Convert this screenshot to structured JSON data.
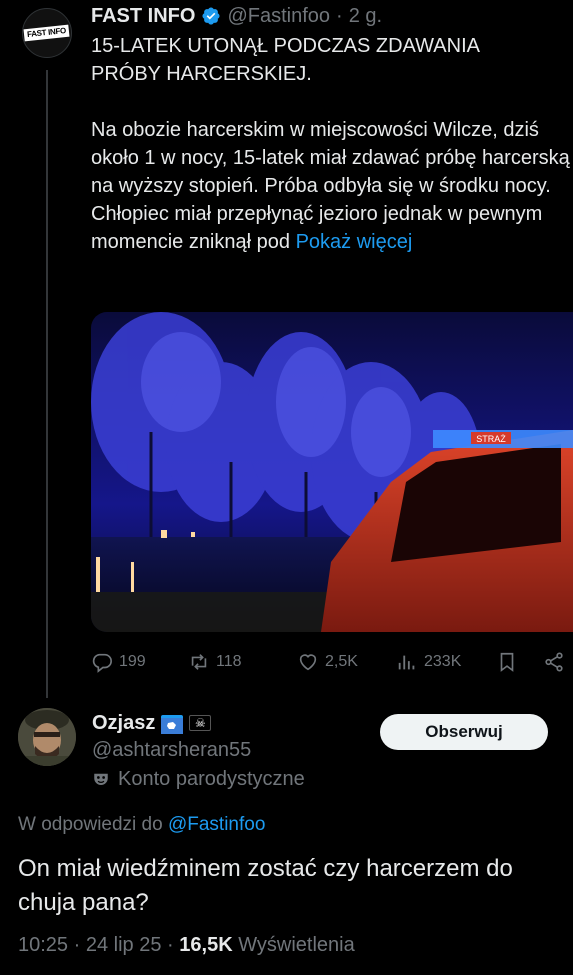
{
  "tweet": {
    "avatar_logo": "FAST INFO",
    "name": "FAST INFO",
    "handle": "@Fastinfoo",
    "separator": "·",
    "time": "2 g.",
    "text": "15-LATEK UTONĄŁ PODCZAS ZDAWANIA\nPRÓBY HARCERSKIEJ.\n\nNa obozie harcerskim w miejscowości Wilcze, dziś około 1 w nocy, 15-latek miał zdawać próbę harcerską na wyższy stopień. Próba odbyła się w środku nocy. Chłopiec miał przepłynąć jezioro jednak w pewnym momencie zniknął pod ",
    "show_more": "Pokaż więcej",
    "media_vehicle_text": "STRAŻ",
    "actions": {
      "replies": "199",
      "reposts": "118",
      "likes": "2,5K",
      "views": "233K"
    }
  },
  "reply": {
    "name": "Ozjasz",
    "handle": "@ashtarsheran55",
    "parody_label": "Konto parodystyczne",
    "follow_label": "Obserwuj",
    "replying_to_prefix": "W odpowiedzi do ",
    "replying_to_handle": "@Fastinfoo",
    "text": "On miał wiedźminem zostać czy harcerzem do chuja pana?",
    "time": "10:25",
    "date": "24 lip 25",
    "separator": "·",
    "views_count": "16,5K",
    "views_label": "Wyświetlenia"
  },
  "colors": {
    "background": "#000000",
    "text": "#e7e9ea",
    "muted": "#71767b",
    "accent": "#1d9bf0"
  }
}
